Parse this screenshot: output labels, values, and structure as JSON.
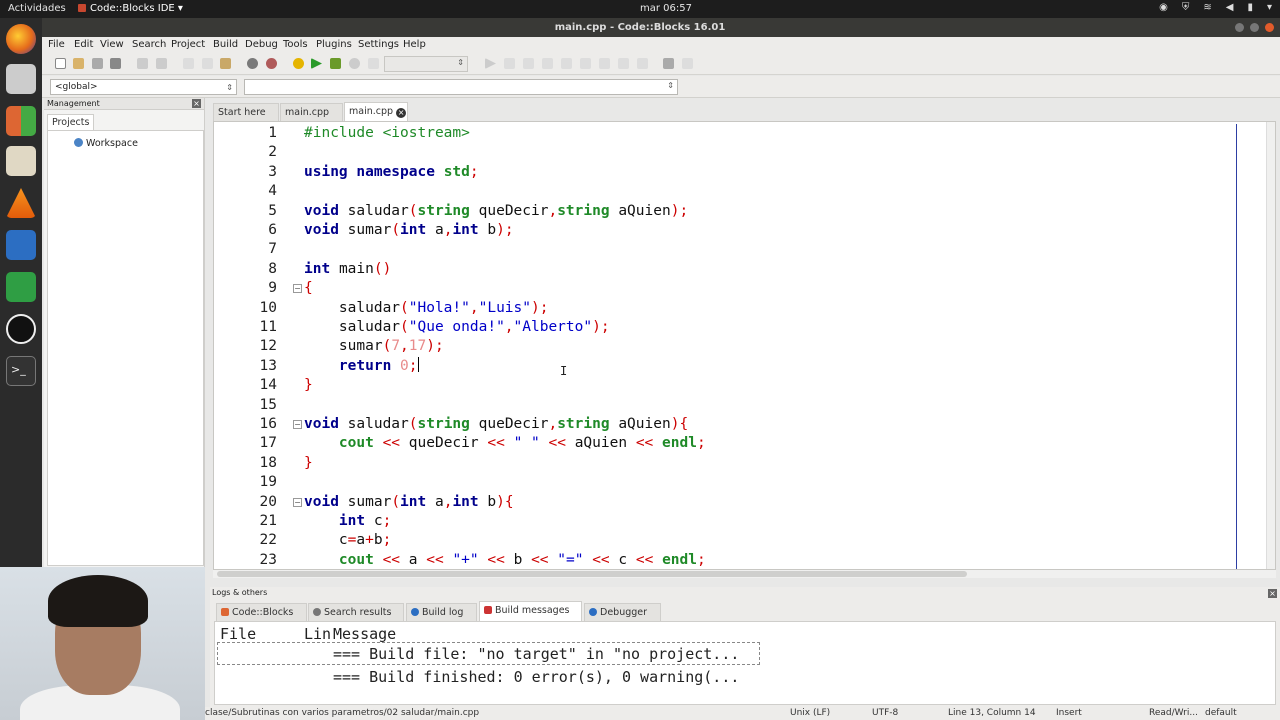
{
  "topbar": {
    "activities": "Actividades",
    "app": "Code::Blocks IDE",
    "clock": "mar 06:57"
  },
  "window": {
    "title": "main.cpp - Code::Blocks 16.01"
  },
  "menu": [
    "File",
    "Edit",
    "View",
    "Search",
    "Project",
    "Build",
    "Debug",
    "Tools",
    "Plugins",
    "Settings",
    "Help"
  ],
  "scope": {
    "selected": "<global>"
  },
  "management": {
    "title": "Management",
    "tab": "Projects",
    "workspace": "Workspace"
  },
  "editor_tabs": [
    "Start here",
    "main.cpp",
    "main.cpp"
  ],
  "code": {
    "lines": [
      "#include <iostream>",
      "",
      "using namespace std;",
      "",
      "void saludar(string queDecir,string aQuien);",
      "void sumar(int a,int b);",
      "",
      "int main()",
      "{",
      "    saludar(\"Hola!\",\"Luis\");",
      "    saludar(\"Que onda!\",\"Alberto\");",
      "    sumar(7,17);",
      "    return 0;",
      "}",
      "",
      "void saludar(string queDecir,string aQuien){",
      "    cout << queDecir << \" \" << aQuien << endl;",
      "}",
      "",
      "void sumar(int a,int b){",
      "    int c;",
      "    c=a+b;",
      "    cout << a << \"+\" << b << \"=\" << c << endl;"
    ],
    "numbers": [
      "1",
      "2",
      "3",
      "4",
      "5",
      "6",
      "7",
      "8",
      "9",
      "10",
      "11",
      "12",
      "13",
      "14",
      "15",
      "16",
      "17",
      "18",
      "19",
      "20",
      "21",
      "22",
      "23"
    ]
  },
  "logs": {
    "title": "Logs & others",
    "tabs": [
      "Code::Blocks",
      "Search results",
      "Build log",
      "Build messages",
      "Debugger"
    ],
    "columns": [
      "File",
      "Lin",
      "Message"
    ],
    "rows": [
      "=== Build file: \"no target\" in \"no project...",
      "=== Build finished: 0 error(s), 0 warning(..."
    ]
  },
  "status": {
    "path": "clase/Subrutinas con varios parametros/02 saludar/main.cpp",
    "eol": "Unix (LF)",
    "encoding": "UTF-8",
    "position": "Line 13, Column 14",
    "mode": "Insert",
    "access": "Read/Wri...",
    "profile": "default"
  },
  "colors": {
    "keyword": "#00008b",
    "type": "#1f8a28",
    "string": "#0000c8",
    "operator": "#cc0000"
  }
}
